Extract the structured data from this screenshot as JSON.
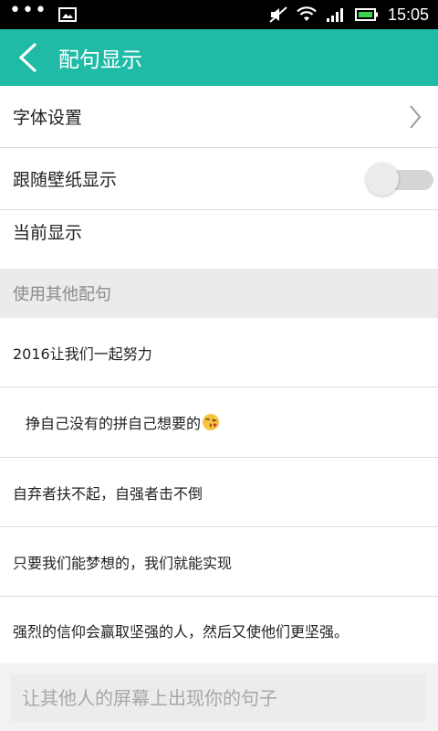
{
  "status_bar": {
    "time": "15:05",
    "icons": [
      "more-dots-icon",
      "image-icon",
      "mute-icon",
      "wifi-icon",
      "signal-icon",
      "battery-icon"
    ]
  },
  "app_bar": {
    "title": "配句显示",
    "back_icon": "chevron-left-icon",
    "color": "#1fbba6"
  },
  "settings": {
    "font_setting": "字体设置",
    "follow_wallpaper": "跟随壁纸显示",
    "follow_wallpaper_on": false,
    "current_display": "当前显示"
  },
  "other_phrases": {
    "header": "使用其他配句",
    "items": [
      "2016让我们一起努力",
      "挣自己没有的拼自己想要的",
      "自弃者扶不起，自强者击不倒",
      "只要我们能梦想的，我们就能实现",
      "强烈的信仰会赢取坚强的人，然后又使他们更坚强。"
    ]
  },
  "bottom": {
    "placeholder": "让其他人的屏幕上出现你的句子"
  }
}
